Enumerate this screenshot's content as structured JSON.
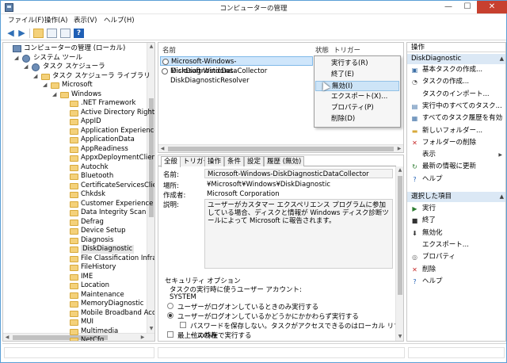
{
  "window": {
    "title": "コンピューターの管理"
  },
  "menu": [
    "ファイル(F)",
    "操作(A)",
    "表示(V)",
    "ヘルプ(H)"
  ],
  "toolbar": {
    "icons": [
      "back-arrow-icon",
      "forward-arrow-icon",
      "up-folder-icon",
      "console-tree-icon",
      "properties-icon",
      "help-icon"
    ],
    "help_glyph": "?"
  },
  "tree": {
    "items": [
      {
        "label": "コンピューターの管理 (ローカル)",
        "level": 0,
        "icon": "computer",
        "exp": ""
      },
      {
        "label": "システム ツール",
        "level": 1,
        "icon": "tools",
        "exp": "◢"
      },
      {
        "label": "タスク スケジューラ",
        "level": 2,
        "icon": "clock",
        "exp": "◢"
      },
      {
        "label": "タスク スケジューラ ライブラリ",
        "level": 3,
        "icon": "folder",
        "exp": "◢"
      },
      {
        "label": "Microsoft",
        "level": 4,
        "icon": "folder",
        "exp": "◢"
      },
      {
        "label": "Windows",
        "level": 5,
        "icon": "folder",
        "exp": "◢"
      },
      {
        "label": ".NET Framework",
        "level": 6,
        "icon": "folder",
        "exp": ""
      },
      {
        "label": "Active Directory Rights",
        "level": 6,
        "icon": "folder",
        "exp": ""
      },
      {
        "label": "AppID",
        "level": 6,
        "icon": "folder",
        "exp": ""
      },
      {
        "label": "Application Experience",
        "level": 6,
        "icon": "folder",
        "exp": ""
      },
      {
        "label": "ApplicationData",
        "level": 6,
        "icon": "folder",
        "exp": ""
      },
      {
        "label": "AppReadiness",
        "level": 6,
        "icon": "folder",
        "exp": ""
      },
      {
        "label": "AppxDeploymentClient",
        "level": 6,
        "icon": "folder",
        "exp": ""
      },
      {
        "label": "Autochk",
        "level": 6,
        "icon": "folder",
        "exp": ""
      },
      {
        "label": "Bluetooth",
        "level": 6,
        "icon": "folder",
        "exp": ""
      },
      {
        "label": "CertificateServicesClien",
        "level": 6,
        "icon": "folder",
        "exp": ""
      },
      {
        "label": "Chkdsk",
        "level": 6,
        "icon": "folder",
        "exp": ""
      },
      {
        "label": "Customer Experience I",
        "level": 6,
        "icon": "folder",
        "exp": ""
      },
      {
        "label": "Data Integrity Scan",
        "level": 6,
        "icon": "folder",
        "exp": ""
      },
      {
        "label": "Defrag",
        "level": 6,
        "icon": "folder",
        "exp": ""
      },
      {
        "label": "Device Setup",
        "level": 6,
        "icon": "folder",
        "exp": ""
      },
      {
        "label": "Diagnosis",
        "level": 6,
        "icon": "folder",
        "exp": ""
      },
      {
        "label": "DiskDiagnostic",
        "level": 6,
        "icon": "folder",
        "exp": "",
        "selected": true
      },
      {
        "label": "File Classification Infras",
        "level": 6,
        "icon": "folder",
        "exp": ""
      },
      {
        "label": "FileHistory",
        "level": 6,
        "icon": "folder",
        "exp": ""
      },
      {
        "label": "IME",
        "level": 6,
        "icon": "folder",
        "exp": ""
      },
      {
        "label": "Location",
        "level": 6,
        "icon": "folder",
        "exp": ""
      },
      {
        "label": "Maintenance",
        "level": 6,
        "icon": "folder",
        "exp": ""
      },
      {
        "label": "MemoryDiagnostic",
        "level": 6,
        "icon": "folder",
        "exp": ""
      },
      {
        "label": "Mobile Broadband Acco",
        "level": 6,
        "icon": "folder",
        "exp": ""
      },
      {
        "label": "MUI",
        "level": 6,
        "icon": "folder",
        "exp": ""
      },
      {
        "label": "Multimedia",
        "level": 6,
        "icon": "folder",
        "exp": ""
      },
      {
        "label": "NetCfg",
        "level": 6,
        "icon": "folder",
        "exp": ""
      }
    ]
  },
  "tasklist": {
    "columns": [
      "名前",
      "状態",
      "トリガー"
    ],
    "rows": [
      {
        "name": "Microsoft-Windows-DiskDiagnosticDataCollector",
        "selected": true
      },
      {
        "name": "Microsoft-Windows-DiskDiagnosticResolver",
        "selected": false
      }
    ]
  },
  "context_menu": {
    "items": [
      "実行する(R)",
      "終了(E)",
      "無効(I)",
      "エクスポート(X)...",
      "プロパティ(P)",
      "削除(D)"
    ],
    "hover_index": 2
  },
  "details": {
    "tabs": [
      "全般",
      "トリガー",
      "操作",
      "条件",
      "設定",
      "履歴 (無効)"
    ],
    "name_label": "名前:",
    "name_value": "Microsoft-Windows-DiskDiagnosticDataCollector",
    "location_label": "場所:",
    "location_value": "¥Microsoft¥Windows¥DiskDiagnostic",
    "author_label": "作成者:",
    "author_value": "Microsoft Corporation",
    "desc_label": "説明:",
    "desc_value": "ユーザーがカスタマー エクスペリエンス プログラムに参加している場合、ディスクと情報が Windows ディスク診断ツールによって Microsoft に報告されます。",
    "security_title": "セキュリティ オプション",
    "run_as_label": "タスクの実行時に使うユーザー アカウント:",
    "run_as_value": "SYSTEM",
    "opt1": "ユーザーがログオンしているときのみ実行する",
    "opt2": "ユーザーがログオンしているかどうかにかかわらず実行する",
    "opt3": "パスワードを保存しない。タスクがアクセスできるのはローカル リソースのみ",
    "opt4": "最上位の特権で実行する"
  },
  "actions": {
    "title": "操作",
    "section1": "DiskDiagnostic",
    "items1": [
      {
        "label": "基本タスクの作成...",
        "icon": "create-basic-task-icon",
        "glyph": "▣",
        "color": "#3b6ea5"
      },
      {
        "label": "タスクの作成...",
        "icon": "create-task-icon",
        "glyph": "◔",
        "color": "#555"
      },
      {
        "label": "タスクのインポート...",
        "icon": "",
        "glyph": "",
        "color": "#555"
      },
      {
        "label": "実行中のすべてのタスク...",
        "icon": "running-tasks-icon",
        "glyph": "▤",
        "color": "#3b6ea5"
      },
      {
        "label": "すべてのタスク履歴を有効",
        "icon": "task-history-icon",
        "glyph": "▦",
        "color": "#3b6ea5"
      },
      {
        "label": "新しいフォルダー...",
        "icon": "new-folder-icon",
        "glyph": "▬",
        "color": "#d7a93a"
      },
      {
        "label": "フォルダーの削除",
        "icon": "delete-folder-icon",
        "glyph": "✕",
        "color": "#c62828"
      },
      {
        "label": "表示",
        "icon": "",
        "glyph": "",
        "color": "#555",
        "submenu": "▶"
      },
      {
        "label": "最新の情報に更新",
        "icon": "refresh-icon",
        "glyph": "↻",
        "color": "#2e7d32"
      },
      {
        "label": "ヘルプ",
        "icon": "help-icon",
        "glyph": "?",
        "color": "#1f5fb5"
      }
    ],
    "section2": "選択した項目",
    "items2": [
      {
        "label": "実行",
        "icon": "run-icon",
        "glyph": "▶",
        "color": "#2e7d32"
      },
      {
        "label": "終了",
        "icon": "stop-icon",
        "glyph": "■",
        "color": "#333"
      },
      {
        "label": "無効化",
        "icon": "disable-icon",
        "glyph": "⬇",
        "color": "#333"
      },
      {
        "label": "エクスポート...",
        "icon": "",
        "glyph": "",
        "color": "#555"
      },
      {
        "label": "プロパティ",
        "icon": "properties-icon",
        "glyph": "◎",
        "color": "#666"
      },
      {
        "label": "削除",
        "icon": "delete-icon",
        "glyph": "✕",
        "color": "#c62828"
      },
      {
        "label": "ヘルプ",
        "icon": "help-icon",
        "glyph": "?",
        "color": "#1f5fb5"
      }
    ],
    "collapse_glyph": "▲"
  },
  "colors": {
    "accent": "#5a9fd6",
    "selection": "#cfe6fb",
    "close": "#c7402f"
  }
}
